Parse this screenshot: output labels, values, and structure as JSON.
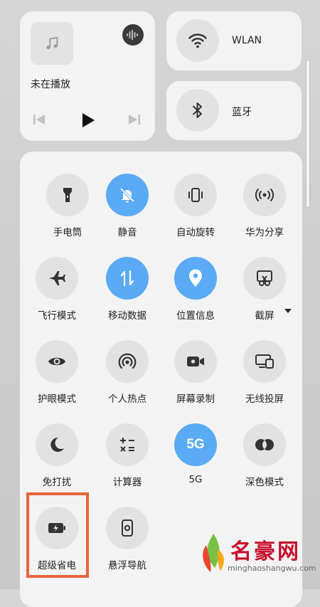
{
  "media": {
    "title": "未在播放",
    "icons": [
      "music-note-icon",
      "voice-assistant-icon",
      "previous-icon",
      "play-icon",
      "next-icon"
    ]
  },
  "wlan": {
    "label": "WLAN",
    "icon": "wifi-icon"
  },
  "bluetooth": {
    "label": "蓝牙",
    "icon": "bluetooth-icon"
  },
  "tiles": [
    {
      "label": "手电筒",
      "icon": "flashlight-icon",
      "active": false
    },
    {
      "label": "静音",
      "icon": "bell-off-icon",
      "active": true
    },
    {
      "label": "自动旋转",
      "icon": "rotate-icon",
      "active": false
    },
    {
      "label": "华为分享",
      "icon": "share-signal-icon",
      "active": false
    },
    {
      "label": "飞行模式",
      "icon": "airplane-icon",
      "active": false
    },
    {
      "label": "移动数据",
      "icon": "mobile-data-icon",
      "active": true
    },
    {
      "label": "位置信息",
      "icon": "location-icon",
      "active": true
    },
    {
      "label": "截屏",
      "icon": "screenshot-icon",
      "active": false
    },
    {
      "label": "护眼模式",
      "icon": "eye-icon",
      "active": false
    },
    {
      "label": "个人热点",
      "icon": "hotspot-icon",
      "active": false
    },
    {
      "label": "屏幕录制",
      "icon": "screen-record-icon",
      "active": false
    },
    {
      "label": "无线投屏",
      "icon": "wireless-projection-icon",
      "active": false
    },
    {
      "label": "免打扰",
      "icon": "moon-icon",
      "active": false
    },
    {
      "label": "计算器",
      "icon": "calculator-icon",
      "active": false
    },
    {
      "label": "5G",
      "icon": "5g-icon",
      "icon_text": "5G",
      "active": true
    },
    {
      "label": "深色模式",
      "icon": "dark-mode-icon",
      "active": false
    },
    {
      "label": "超级省电",
      "icon": "battery-saver-icon",
      "active": false
    },
    {
      "label": "悬浮导航",
      "icon": "floating-nav-icon",
      "active": false
    }
  ],
  "watermark": {
    "text": "名豪网",
    "url": "minghaoshangwu.com"
  },
  "colors": {
    "active": "#5aaaf5",
    "inactive": "#e2e2e2",
    "card": "#f3f3f3",
    "highlight": "#e8643a",
    "watermark": "#c8102e"
  }
}
